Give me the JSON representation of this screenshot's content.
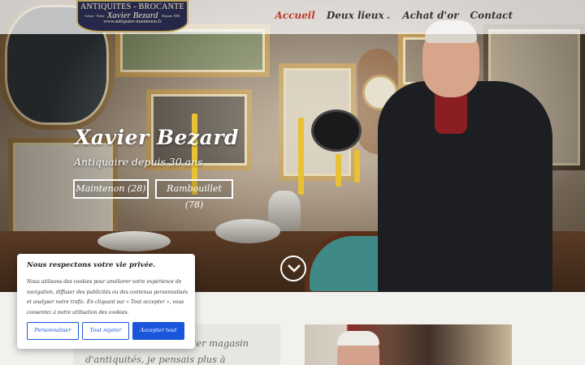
{
  "logo": {
    "line1": "ANTIQUITES - BROCANTE",
    "line2": "Xavier Bezard",
    "line3": "www.antiquaire-maintenon.fr",
    "left_small": "Achat - Vente",
    "right_small": "Depuis 1981"
  },
  "nav": {
    "items": [
      {
        "label": "Accueil",
        "active": true
      },
      {
        "label": "Deux lieux",
        "has_dropdown": true
      },
      {
        "label": "Achat d'or"
      },
      {
        "label": "Contact"
      }
    ],
    "dropdown_icon": "chevron-down-icon",
    "active_color": "#c0392b"
  },
  "hero": {
    "title": "Xavier Bezard",
    "subtitle": "Antiquaire depuis 30 ans",
    "buttons": [
      {
        "label": "Maintenon (28)"
      },
      {
        "label": "Rambouillet (78)"
      }
    ],
    "scroll_icon": "circle-chevron-down-icon"
  },
  "intro": {
    "text": "...ont ouvert leur premier magasin d'antiquités, je pensais plus à"
  },
  "cookie": {
    "title": "Nous respectons votre vie privée.",
    "text": "Nous utilisons des cookies pour améliorer votre expérience de navigation, diffuser des publicités ou des contenus personnalisés et analyser notre trafic. En cliquant sur « Tout accepter », vous consentez à notre utilisation des cookies.",
    "btn_customize": "Personnaliser",
    "btn_reject": "Tout rejeter",
    "btn_accept": "Accepter tout",
    "accent_color": "#1a56db"
  }
}
